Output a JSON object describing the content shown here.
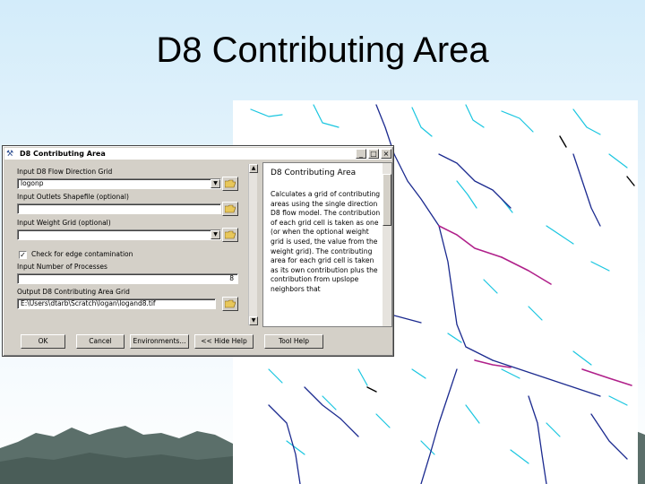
{
  "slide": {
    "title": "D8 Contributing Area"
  },
  "dialog": {
    "title": "D8 Contributing Area",
    "controls": {
      "minimize": "_",
      "maximize": "□",
      "close": "×"
    },
    "fields": {
      "flow_dir_label": "Input D8 Flow Direction Grid",
      "flow_dir_value": "logonp",
      "outlets_label": "Input Outlets Shapefile (optional)",
      "outlets_value": "",
      "weight_label": "Input Weight Grid (optional)",
      "weight_value": "",
      "edge_check_label": "Check for edge contamination",
      "edge_checked": true,
      "processes_label": "Input Number of Processes",
      "processes_value": "8",
      "output_label": "Output D8 Contributing Area Grid",
      "output_value": "E:\\Users\\dtarb\\Scratch\\logan\\logand8.tif"
    },
    "help": {
      "title": "D8 Contributing Area",
      "body": "Calculates a grid of contributing areas using the single direction D8 flow model. The contribution of each grid cell is taken as one (or when the optional weight grid is used, the value from the weight grid). The contributing area for each grid cell is taken as its own contribution plus the contribution from upslope neighbors that"
    },
    "buttons": {
      "ok": "OK",
      "cancel": "Cancel",
      "environments": "Environments...",
      "hide_help": "<< Hide Help",
      "tool_help": "Tool Help"
    }
  }
}
